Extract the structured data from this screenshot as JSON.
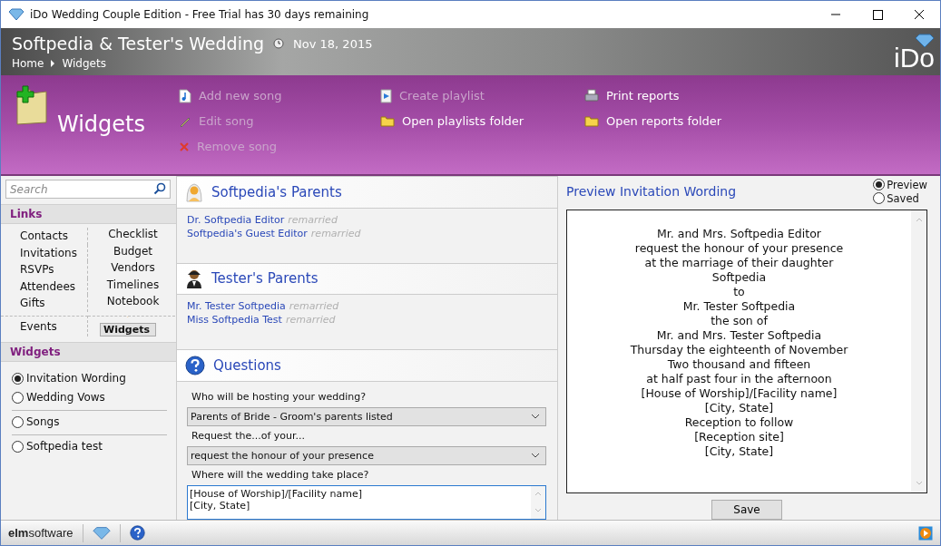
{
  "window": {
    "title": "iDo Wedding Couple Edition - Free Trial has 30 days remaining"
  },
  "header": {
    "title": "Softpedia & Tester's Wedding",
    "date": "Nov 18, 2015",
    "breadcrumb": [
      "Home",
      "Widgets"
    ],
    "logo": "iDo"
  },
  "toolbar": {
    "title": "Widgets",
    "columns": [
      [
        {
          "label": "Add new song",
          "kind": "note",
          "disabled": true
        },
        {
          "label": "Edit song",
          "kind": "pencil",
          "disabled": true
        },
        {
          "label": "Remove song",
          "kind": "cross",
          "disabled": true
        }
      ],
      [
        {
          "label": "Create playlist",
          "kind": "play",
          "disabled": true
        },
        {
          "label": "Open playlists folder",
          "kind": "folder",
          "disabled": false
        }
      ],
      [
        {
          "label": "Print reports",
          "kind": "printer",
          "disabled": false
        },
        {
          "label": "Open reports folder",
          "kind": "folder",
          "disabled": false
        }
      ]
    ]
  },
  "sidebar": {
    "search": {
      "placeholder": "Search"
    },
    "links_title": "Links",
    "links": [
      {
        "label": "Contacts",
        "selected": false
      },
      {
        "label": "Checklist",
        "selected": false
      },
      {
        "label": "Invitations",
        "selected": false
      },
      {
        "label": "Budget",
        "selected": false
      },
      {
        "label": "RSVPs",
        "selected": false
      },
      {
        "label": "Vendors",
        "selected": false
      },
      {
        "label": "Attendees",
        "selected": false
      },
      {
        "label": "Timelines",
        "selected": false
      },
      {
        "label": "Gifts",
        "selected": false
      },
      {
        "label": "Notebook",
        "selected": false
      },
      {
        "label": "Events",
        "selected": false
      },
      {
        "label": "Widgets",
        "selected": true
      }
    ],
    "widgets_title": "Widgets",
    "widget_groups": [
      [
        {
          "label": "Invitation Wording",
          "selected": true
        },
        {
          "label": "Wedding Vows",
          "selected": false
        }
      ],
      [
        {
          "label": "Songs",
          "selected": false
        }
      ],
      [
        {
          "label": "Softpedia test",
          "selected": false
        }
      ]
    ]
  },
  "parents": [
    {
      "title": "Softpedia's Parents",
      "kind": "bride",
      "people": [
        {
          "name": "Dr. Softpedia Editor",
          "note": "remarried"
        },
        {
          "name": "Softpedia's Guest Editor",
          "note": "remarried"
        }
      ]
    },
    {
      "title": "Tester's Parents",
      "kind": "groom",
      "people": [
        {
          "name": "Mr. Tester Softpedia",
          "note": "remarried"
        },
        {
          "name": "Miss Softpedia Test",
          "note": "remarried"
        }
      ]
    }
  ],
  "questions": {
    "title": "Questions",
    "items": [
      {
        "kind": "select",
        "label": "Who will be hosting your wedding?",
        "value": "Parents of Bride - Groom's parents listed"
      },
      {
        "kind": "select",
        "label": "Request the...of your...",
        "value": "request the honour of your presence"
      },
      {
        "kind": "text",
        "label": "Where will the wedding take place?",
        "value": "[House of Worship]/[Facility name]\n[City, State]"
      }
    ]
  },
  "preview": {
    "title": "Preview Invitation Wording",
    "modes": [
      {
        "label": "Preview",
        "selected": true
      },
      {
        "label": "Saved",
        "selected": false
      }
    ],
    "lines": [
      "Mr. and Mrs. Softpedia Editor",
      "request the honour of your presence",
      "at the marriage of their daughter",
      "Softpedia",
      "to",
      "Mr. Tester Softpedia",
      "the son of",
      "Mr. and Mrs. Tester Softpedia",
      "Thursday the eighteenth of November",
      "Two thousand and fifteen",
      "at half past four in the afternoon",
      "[House of Worship]/[Facility name]",
      "[City, State]",
      "Reception to follow",
      "[Reception site]",
      "[City, State]"
    ],
    "save": "Save"
  },
  "footer": {
    "brand_bold": "elm",
    "brand": "software"
  }
}
